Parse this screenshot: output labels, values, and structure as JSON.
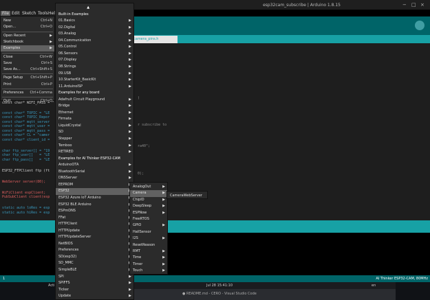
{
  "window": {
    "title": "esp32cam_subscribe | Arduino 1.8.15",
    "controls": [
      "−",
      "□",
      "×"
    ]
  },
  "menubar": [
    "File",
    "Edit",
    "Sketch",
    "Tools",
    "Help"
  ],
  "tab": {
    "label": "camera_pins.h"
  },
  "code_lines": [
    {
      "text": "const char* WIFI_SSID = \"",
      "c": "white"
    },
    {
      "text": "const char* WIFI_PASS = \"",
      "c": "white"
    },
    {
      "text": "",
      "c": "white"
    },
    {
      "text": "const char* TOPIC = \"LE",
      "c": "blue"
    },
    {
      "text": "const char* TOPIC_Repor",
      "c": "blue"
    },
    {
      "text": "const char* mqtt_server",
      "c": "blue"
    },
    {
      "text": "const char* mqtt_user =",
      "c": "blue"
    },
    {
      "text": "const char* mqtt_pass =",
      "c": "blue"
    },
    {
      "text": "const char* CL = \"camer",
      "c": "blue"
    },
    {
      "text": "const char* client_id =",
      "c": "blue"
    },
    {
      "text": "",
      "c": "white"
    },
    {
      "text": "char ftp_server[] = \"19",
      "c": "blue"
    },
    {
      "text": "char ftp_user[]   = \"LE",
      "c": "blue"
    },
    {
      "text": "char ftp_pass[]   = \"LE",
      "c": "blue"
    },
    {
      "text": "",
      "c": "white"
    },
    {
      "text": "ESP32_FTPClient ftp (ft",
      "c": "white"
    },
    {
      "text": "",
      "c": "white"
    },
    {
      "text": "WebServer server(80);",
      "c": "red"
    },
    {
      "text": "",
      "c": "white"
    },
    {
      "text": "WiFiClient espClient;",
      "c": "red"
    },
    {
      "text": "PubSubClient client(esp",
      "c": "red"
    },
    {
      "text": "",
      "c": "white"
    },
    {
      "text": "static auto loRes = esp",
      "c": "blue"
    },
    {
      "text": "static auto hiRes = esp",
      "c": "blue"
    }
  ],
  "code_tail": [
    {
      "text": "r subscribe to",
      "line": 4
    },
    {
      "text": "ra40\";",
      "line": 9
    },
    {
      "text": "0);",
      "line": 15
    },
    {
      "text": ")",
      "line": 0
    }
  ],
  "file_menu": [
    {
      "label": "New",
      "shortcut": "Ctrl+N"
    },
    {
      "label": "Open...",
      "shortcut": "Ctrl+O"
    },
    {
      "label": "Open Recent",
      "arrow": true
    },
    {
      "label": "Sketchbook",
      "arrow": true
    },
    {
      "label": "Examples",
      "arrow": true,
      "hl": true
    },
    {
      "label": "Close",
      "shortcut": "Ctrl+W"
    },
    {
      "label": "Save",
      "shortcut": "Ctrl+S"
    },
    {
      "label": "Save As...",
      "shortcut": "Ctrl+Shift+S"
    },
    {
      "label": "Page Setup",
      "shortcut": "Ctrl+Shift+P"
    },
    {
      "label": "Print",
      "shortcut": "Ctrl+P"
    },
    {
      "label": "Preferences",
      "shortcut": "Ctrl+Comma"
    },
    {
      "label": "Quit",
      "shortcut": "Ctrl+Q"
    }
  ],
  "examples_menu": [
    {
      "label": "▲",
      "hdr": true
    },
    {
      "label": "Built-in Examples",
      "hdr": true
    },
    {
      "label": "01.Basics",
      "arrow": true
    },
    {
      "label": "02.Digital",
      "arrow": true
    },
    {
      "label": "03.Analog",
      "arrow": true
    },
    {
      "label": "04.Communication",
      "arrow": true
    },
    {
      "label": "05.Control",
      "arrow": true
    },
    {
      "label": "06.Sensors",
      "arrow": true
    },
    {
      "label": "07.Display",
      "arrow": true
    },
    {
      "label": "08.Strings",
      "arrow": true
    },
    {
      "label": "09.USB",
      "arrow": true
    },
    {
      "label": "10.StarterKit_BasicKit",
      "arrow": true
    },
    {
      "label": "11.ArduinoISP",
      "arrow": true
    },
    {
      "label": "Examples for any board",
      "hdr": true
    },
    {
      "label": "Adafruit Circuit Playground",
      "arrow": true
    },
    {
      "label": "Bridge",
      "arrow": true
    },
    {
      "label": "Ethernet",
      "arrow": true
    },
    {
      "label": "Firmata",
      "arrow": true
    },
    {
      "label": "LiquidCrystal",
      "arrow": true
    },
    {
      "label": "SD",
      "arrow": true
    },
    {
      "label": "Stepper",
      "arrow": true
    },
    {
      "label": "Temboo",
      "arrow": true
    },
    {
      "label": "RETIRED",
      "arrow": true
    },
    {
      "label": "Examples for AI Thinker ESP32-CAM",
      "hdr": true
    },
    {
      "label": "ArduinoOTA",
      "arrow": true
    },
    {
      "label": "BluetoothSerial",
      "arrow": true
    },
    {
      "label": "DNSServer",
      "arrow": true
    },
    {
      "label": "EEPROM",
      "arrow": true
    },
    {
      "label": "ESP32",
      "arrow": true,
      "hl": true
    },
    {
      "label": "ESP32 Azure IoT Arduino",
      "arrow": true
    },
    {
      "label": "ESP32 BLE Arduino",
      "arrow": true
    },
    {
      "label": "ESPmDNS",
      "arrow": true
    },
    {
      "label": "FFat",
      "arrow": true
    },
    {
      "label": "HTTPClient",
      "arrow": true
    },
    {
      "label": "HTTPUpdate",
      "arrow": true
    },
    {
      "label": "HTTPUpdateServer",
      "arrow": true
    },
    {
      "label": "NetBIOS",
      "arrow": true
    },
    {
      "label": "Preferences",
      "arrow": true
    },
    {
      "label": "SD(esp32)",
      "arrow": true
    },
    {
      "label": "SD_MMC",
      "arrow": true
    },
    {
      "label": "SimpleBLE",
      "arrow": true
    },
    {
      "label": "SPI",
      "arrow": true
    },
    {
      "label": "SPIFFS",
      "arrow": true
    },
    {
      "label": "Ticker",
      "arrow": true
    },
    {
      "label": "Update",
      "arrow": true
    }
  ],
  "esp32_menu": [
    {
      "label": "AnalogOut",
      "arrow": true
    },
    {
      "label": "Camera",
      "arrow": true,
      "hl": true
    },
    {
      "label": "ChipID",
      "arrow": true
    },
    {
      "label": "DeepSleep",
      "arrow": true
    },
    {
      "label": "ESPNow",
      "arrow": true
    },
    {
      "label": "FreeRTOS"
    },
    {
      "label": "GPIO",
      "arrow": true
    },
    {
      "label": "HallSensor"
    },
    {
      "label": "I2S",
      "arrow": true
    },
    {
      "label": "ResetReason"
    },
    {
      "label": "RMT",
      "arrow": true
    },
    {
      "label": "Time",
      "arrow": true
    },
    {
      "label": "Timer",
      "arrow": true
    },
    {
      "label": "Touch",
      "arrow": true
    }
  ],
  "camera_menu": [
    {
      "label": "CameraWebServer"
    }
  ],
  "status": {
    "line": "1",
    "board": "AI Thinker ESP32-CAM, 80MHz"
  },
  "taskbar": {
    "left": "Acti",
    "clock": "Jul 28  15:41:10",
    "lang": "en",
    "vscode_title": "● README.md - CERO - Visual Studio Code"
  },
  "colors": {
    "teal_dark": "#006468",
    "teal": "#17a1a5",
    "menu_bg": "#2b2b2b",
    "menu_hl": "#616161",
    "editor_bg": "#1e1e1e"
  }
}
